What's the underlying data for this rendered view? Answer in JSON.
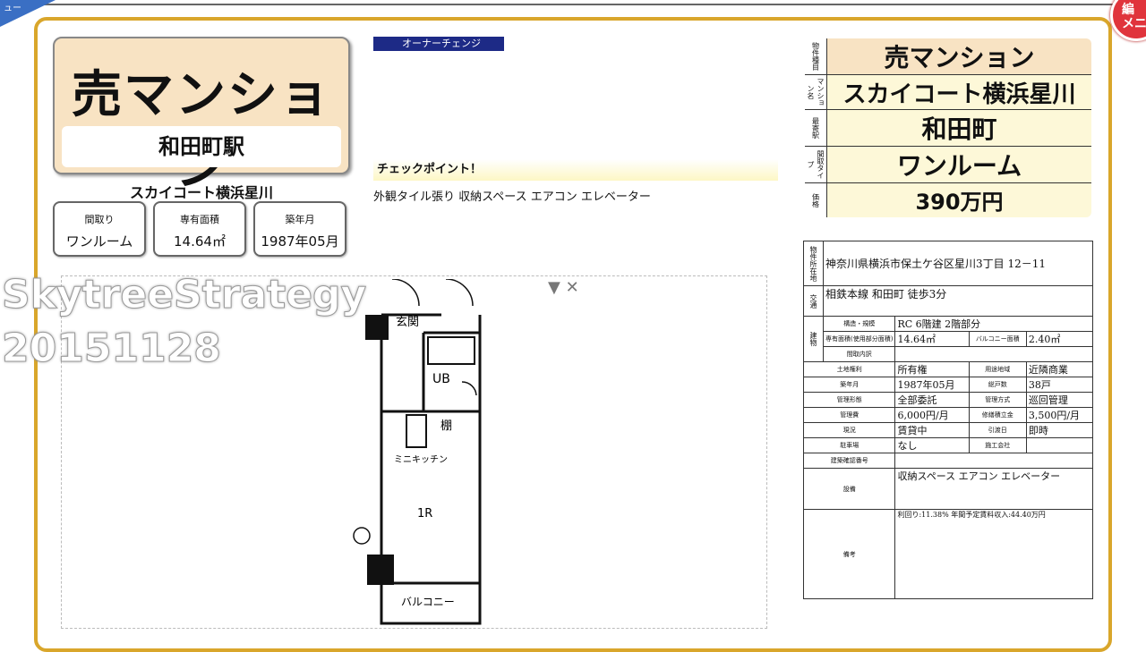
{
  "menu": {
    "tab_label": "ュー",
    "badge_label": "編\nメニ"
  },
  "left": {
    "sale_type": "売マンション",
    "station": "和田町駅",
    "property_name": "スカイコート横浜星川",
    "specs": [
      {
        "key": "間取り",
        "value": "ワンルーム"
      },
      {
        "key": "専有面積",
        "value": "14.64㎡"
      },
      {
        "key": "築年月",
        "value": "1987年05月"
      }
    ]
  },
  "center": {
    "owner_change": "オーナーチェンジ",
    "check_title": "チェックポイント！",
    "check_text": "外観タイル張り 収納スペース エアコン エレベーター",
    "watermark": [
      "SkytreeStrategy",
      "20151128"
    ],
    "plan_labels": {
      "entrance": "玄関",
      "ub": "UB",
      "shelf": "棚",
      "kitchen": "ミニキッチン",
      "room": "1R",
      "balcony": "バルコニー"
    },
    "plan_ctrl": "▼ ✕"
  },
  "summary": [
    {
      "label": "物件種目",
      "value": "売マンション"
    },
    {
      "label": "マンション名",
      "value": "スカイコート横浜星川"
    },
    {
      "label": "最寄駅",
      "value": "和田町"
    },
    {
      "label": "間取タイプ",
      "value": "ワンルーム"
    },
    {
      "label": "価格",
      "value": "390万円"
    }
  ],
  "detail": {
    "location_label": "物件所在地",
    "location": "神奈川県横浜市保土ケ谷区星川3丁目 12－11",
    "transport_label": "交通",
    "transport": "相鉄本線 和田町 徒歩3分",
    "building_label": "建物",
    "structure_label": "構造・規模",
    "structure": "RC 6階建 2階部分",
    "area_label": "専有面積(使用部分面積)",
    "area": "14.64㎡",
    "balcony_label": "バルコニー面積",
    "balcony": "2.40㎡",
    "layout_label": "間取内訳",
    "land_label": "土地権利",
    "land": "所有権",
    "zone_label": "用途地域",
    "zone": "近隣商業",
    "built_label": "築年月",
    "built": "1987年05月",
    "units_label": "総戸数",
    "units": "38戸",
    "mgmt_form_label": "管理形態",
    "mgmt_form": "全部委託",
    "mgmt_method_label": "管理方式",
    "mgmt_method": "巡回管理",
    "mgmt_fee_label": "管理費",
    "mgmt_fee": "6,000円/月",
    "repair_label": "修繕積立金",
    "repair": "3,500円/月",
    "status_label": "現況",
    "status": "賃貸中",
    "handover_label": "引渡日",
    "handover": "即時",
    "parking_label": "駐車場",
    "parking": "なし",
    "builder_label": "施工会社",
    "builder": "",
    "confirm_label": "建築確認番号",
    "equip_label": "設備",
    "equip": "収納スペース エアコン エレベーター",
    "remarks_label": "備考",
    "remarks": "利回り:11.38% 年間予定賃料収入:44.40万円"
  }
}
